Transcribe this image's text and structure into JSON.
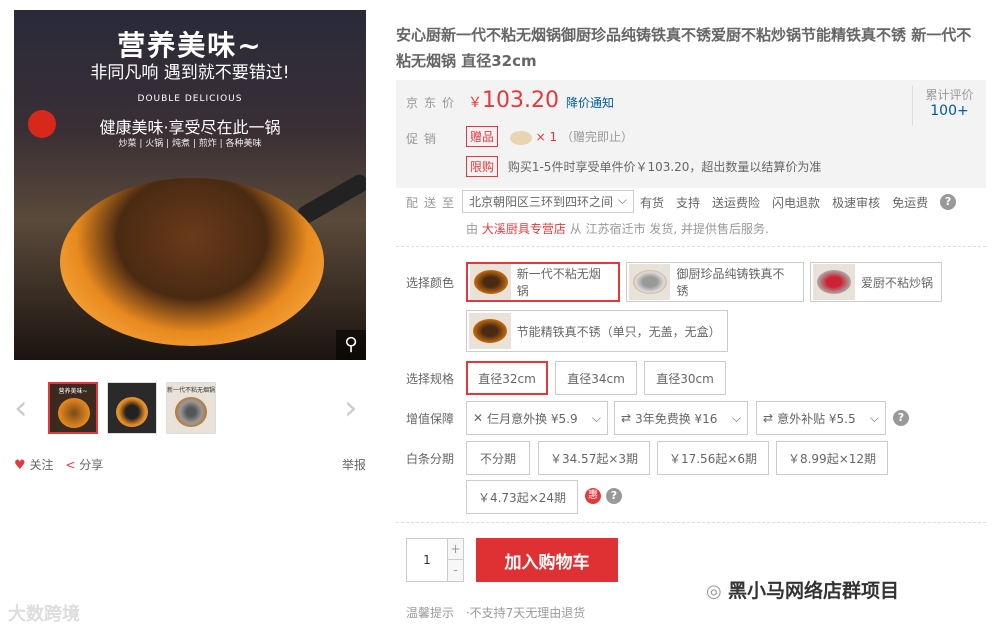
{
  "gallery": {
    "headline": "营养美味~",
    "subline": "非同凡响 遇到就不要错过!",
    "english": "DOUBLE DELICIOUS",
    "health": "健康美味·享受尽在此一锅",
    "cats": "炒菜 | 火锅 | 炖煮 | 煎炸 | 各种美味",
    "zoom_icon": "⚲",
    "prev": "‹",
    "next": "›",
    "thumb_captions": [
      "营养美味~",
      "",
      "新一代不粘无烟锅"
    ],
    "follow": "关注",
    "share": "分享",
    "report": "举报",
    "watermark": "大数跨境"
  },
  "product": {
    "title": "安心厨新一代不粘无烟锅御厨珍品纯铸铁真不锈爱厨不粘炒锅节能精铁真不锈 新一代不粘无烟锅 直径32cm"
  },
  "price": {
    "label": "京东价",
    "currency": "￥",
    "value": "103.20",
    "notice": "降价通知",
    "cum_label": "累计评价",
    "cum_value": "100+"
  },
  "promo": {
    "label": "促销",
    "gift_tag": "赠品",
    "gift_qty": "× 1",
    "gift_note": "（赠完即止）",
    "limit_tag": "限购",
    "limit_text": "购买1-5件时享受单件价￥103.20，超出数量以结算价为准"
  },
  "delivery": {
    "label": "配送至",
    "location": "北京朝阳区三环到四环之间",
    "services": [
      "有货",
      "支持",
      "送运费险",
      "闪电退款",
      "极速审核",
      "免运费"
    ],
    "from_prefix": "由",
    "store": "大溪厨具专营店",
    "from_suffix": "从 江苏宿迁市 发货, 并提供售后服务."
  },
  "color": {
    "label": "选择颜色",
    "options": [
      "新一代不粘无烟锅",
      "御厨珍品纯铸铁真不锈",
      "爱厨不粘炒锅",
      "节能精铁真不锈（单只，无盖，无盒）"
    ]
  },
  "size": {
    "label": "选择规格",
    "options": [
      "直径32cm",
      "直径34cm",
      "直径30cm"
    ]
  },
  "protect": {
    "label": "增值保障",
    "options": [
      "仨月意外换 ¥5.9",
      "3年免费换 ¥16",
      "意外补贴 ¥5.5"
    ]
  },
  "installment": {
    "label": "白条分期",
    "options": [
      "不分期",
      "￥34.57起×3期",
      "￥17.56起×6期",
      "￥8.99起×12期",
      "￥4.73起×24期"
    ],
    "hui": "惠"
  },
  "cart": {
    "qty": "1",
    "plus": "+",
    "minus": "-",
    "button": "加入购物车"
  },
  "tips": {
    "label": "温馨提示",
    "text": "·不支持7天无理由退货"
  },
  "watermark_right": "黑小马网络店群项目",
  "colors": {
    "accent": "#e4393c",
    "link": "#005aa0"
  }
}
